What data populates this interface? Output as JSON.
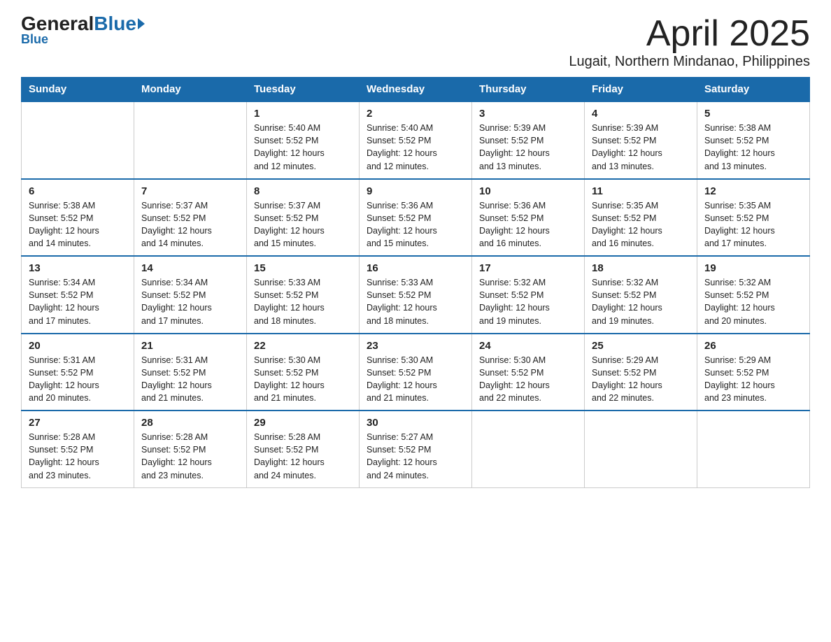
{
  "logo": {
    "general": "General",
    "blue": "Blue",
    "subtitle": "Blue"
  },
  "header": {
    "title": "April 2025",
    "subtitle": "Lugait, Northern Mindanao, Philippines"
  },
  "days_of_week": [
    "Sunday",
    "Monday",
    "Tuesday",
    "Wednesday",
    "Thursday",
    "Friday",
    "Saturday"
  ],
  "weeks": [
    [
      {
        "day": "",
        "info": ""
      },
      {
        "day": "",
        "info": ""
      },
      {
        "day": "1",
        "info": "Sunrise: 5:40 AM\nSunset: 5:52 PM\nDaylight: 12 hours\nand 12 minutes."
      },
      {
        "day": "2",
        "info": "Sunrise: 5:40 AM\nSunset: 5:52 PM\nDaylight: 12 hours\nand 12 minutes."
      },
      {
        "day": "3",
        "info": "Sunrise: 5:39 AM\nSunset: 5:52 PM\nDaylight: 12 hours\nand 13 minutes."
      },
      {
        "day": "4",
        "info": "Sunrise: 5:39 AM\nSunset: 5:52 PM\nDaylight: 12 hours\nand 13 minutes."
      },
      {
        "day": "5",
        "info": "Sunrise: 5:38 AM\nSunset: 5:52 PM\nDaylight: 12 hours\nand 13 minutes."
      }
    ],
    [
      {
        "day": "6",
        "info": "Sunrise: 5:38 AM\nSunset: 5:52 PM\nDaylight: 12 hours\nand 14 minutes."
      },
      {
        "day": "7",
        "info": "Sunrise: 5:37 AM\nSunset: 5:52 PM\nDaylight: 12 hours\nand 14 minutes."
      },
      {
        "day": "8",
        "info": "Sunrise: 5:37 AM\nSunset: 5:52 PM\nDaylight: 12 hours\nand 15 minutes."
      },
      {
        "day": "9",
        "info": "Sunrise: 5:36 AM\nSunset: 5:52 PM\nDaylight: 12 hours\nand 15 minutes."
      },
      {
        "day": "10",
        "info": "Sunrise: 5:36 AM\nSunset: 5:52 PM\nDaylight: 12 hours\nand 16 minutes."
      },
      {
        "day": "11",
        "info": "Sunrise: 5:35 AM\nSunset: 5:52 PM\nDaylight: 12 hours\nand 16 minutes."
      },
      {
        "day": "12",
        "info": "Sunrise: 5:35 AM\nSunset: 5:52 PM\nDaylight: 12 hours\nand 17 minutes."
      }
    ],
    [
      {
        "day": "13",
        "info": "Sunrise: 5:34 AM\nSunset: 5:52 PM\nDaylight: 12 hours\nand 17 minutes."
      },
      {
        "day": "14",
        "info": "Sunrise: 5:34 AM\nSunset: 5:52 PM\nDaylight: 12 hours\nand 17 minutes."
      },
      {
        "day": "15",
        "info": "Sunrise: 5:33 AM\nSunset: 5:52 PM\nDaylight: 12 hours\nand 18 minutes."
      },
      {
        "day": "16",
        "info": "Sunrise: 5:33 AM\nSunset: 5:52 PM\nDaylight: 12 hours\nand 18 minutes."
      },
      {
        "day": "17",
        "info": "Sunrise: 5:32 AM\nSunset: 5:52 PM\nDaylight: 12 hours\nand 19 minutes."
      },
      {
        "day": "18",
        "info": "Sunrise: 5:32 AM\nSunset: 5:52 PM\nDaylight: 12 hours\nand 19 minutes."
      },
      {
        "day": "19",
        "info": "Sunrise: 5:32 AM\nSunset: 5:52 PM\nDaylight: 12 hours\nand 20 minutes."
      }
    ],
    [
      {
        "day": "20",
        "info": "Sunrise: 5:31 AM\nSunset: 5:52 PM\nDaylight: 12 hours\nand 20 minutes."
      },
      {
        "day": "21",
        "info": "Sunrise: 5:31 AM\nSunset: 5:52 PM\nDaylight: 12 hours\nand 21 minutes."
      },
      {
        "day": "22",
        "info": "Sunrise: 5:30 AM\nSunset: 5:52 PM\nDaylight: 12 hours\nand 21 minutes."
      },
      {
        "day": "23",
        "info": "Sunrise: 5:30 AM\nSunset: 5:52 PM\nDaylight: 12 hours\nand 21 minutes."
      },
      {
        "day": "24",
        "info": "Sunrise: 5:30 AM\nSunset: 5:52 PM\nDaylight: 12 hours\nand 22 minutes."
      },
      {
        "day": "25",
        "info": "Sunrise: 5:29 AM\nSunset: 5:52 PM\nDaylight: 12 hours\nand 22 minutes."
      },
      {
        "day": "26",
        "info": "Sunrise: 5:29 AM\nSunset: 5:52 PM\nDaylight: 12 hours\nand 23 minutes."
      }
    ],
    [
      {
        "day": "27",
        "info": "Sunrise: 5:28 AM\nSunset: 5:52 PM\nDaylight: 12 hours\nand 23 minutes."
      },
      {
        "day": "28",
        "info": "Sunrise: 5:28 AM\nSunset: 5:52 PM\nDaylight: 12 hours\nand 23 minutes."
      },
      {
        "day": "29",
        "info": "Sunrise: 5:28 AM\nSunset: 5:52 PM\nDaylight: 12 hours\nand 24 minutes."
      },
      {
        "day": "30",
        "info": "Sunrise: 5:27 AM\nSunset: 5:52 PM\nDaylight: 12 hours\nand 24 minutes."
      },
      {
        "day": "",
        "info": ""
      },
      {
        "day": "",
        "info": ""
      },
      {
        "day": "",
        "info": ""
      }
    ]
  ]
}
